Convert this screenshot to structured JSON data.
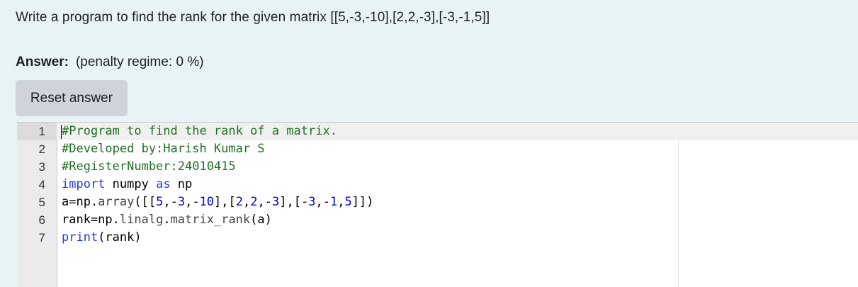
{
  "question": {
    "text": "Write a program to find the rank for the given matrix [[5,-3,-10],[2,2,-3],[-3,-1,5]]"
  },
  "answer": {
    "label": "Answer:",
    "penalty": "(penalty regime: 0 %)"
  },
  "reset_button": {
    "label": "Reset answer"
  },
  "editor": {
    "line_numbers": [
      "1",
      "2",
      "3",
      "4",
      "5",
      "6",
      "7"
    ],
    "lines": [
      {
        "tokens": [
          {
            "t": "#Program to find the rank of a matrix.",
            "c": "comment"
          }
        ]
      },
      {
        "tokens": [
          {
            "t": "#Developed by:Harish Kumar S",
            "c": "comment"
          }
        ]
      },
      {
        "tokens": [
          {
            "t": "#RegisterNumber:24010415",
            "c": "comment"
          }
        ]
      },
      {
        "tokens": [
          {
            "t": "import",
            "c": "kw"
          },
          {
            "t": " numpy ",
            "c": ""
          },
          {
            "t": "as",
            "c": "kw"
          },
          {
            "t": " np",
            "c": ""
          }
        ]
      },
      {
        "tokens": [
          {
            "t": "a=np.",
            "c": ""
          },
          {
            "t": "array",
            "c": "method"
          },
          {
            "t": "([[",
            "c": ""
          },
          {
            "t": "5",
            "c": "num"
          },
          {
            "t": ",-",
            "c": ""
          },
          {
            "t": "3",
            "c": "num"
          },
          {
            "t": ",-",
            "c": ""
          },
          {
            "t": "10",
            "c": "num"
          },
          {
            "t": "],[",
            "c": ""
          },
          {
            "t": "2",
            "c": "num"
          },
          {
            "t": ",",
            "c": ""
          },
          {
            "t": "2",
            "c": "num"
          },
          {
            "t": ",-",
            "c": ""
          },
          {
            "t": "3",
            "c": "num"
          },
          {
            "t": "],[-",
            "c": ""
          },
          {
            "t": "3",
            "c": "num"
          },
          {
            "t": ",-",
            "c": ""
          },
          {
            "t": "1",
            "c": "num"
          },
          {
            "t": ",",
            "c": ""
          },
          {
            "t": "5",
            "c": "num"
          },
          {
            "t": "]])",
            "c": ""
          }
        ]
      },
      {
        "tokens": [
          {
            "t": "rank=np.",
            "c": ""
          },
          {
            "t": "linalg",
            "c": "method"
          },
          {
            "t": ".",
            "c": ""
          },
          {
            "t": "matrix_rank",
            "c": "method"
          },
          {
            "t": "(a)",
            "c": ""
          }
        ]
      },
      {
        "tokens": [
          {
            "t": "print",
            "c": "fn"
          },
          {
            "t": "(rank)",
            "c": ""
          }
        ]
      }
    ]
  }
}
